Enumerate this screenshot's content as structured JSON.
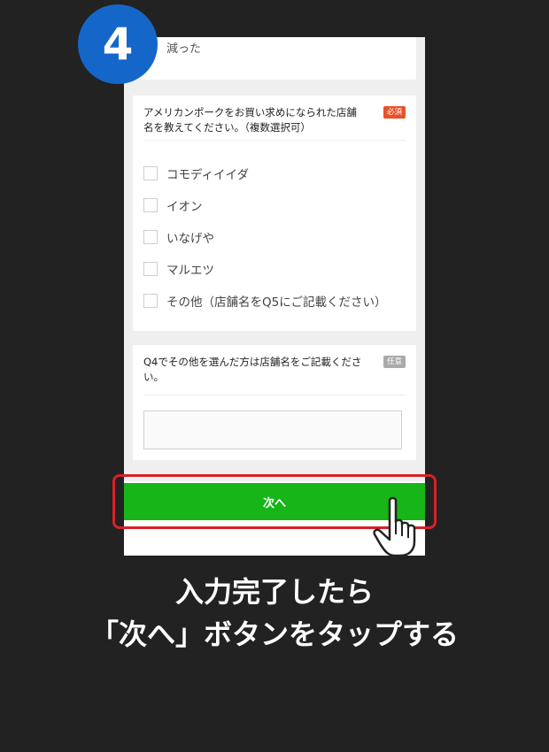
{
  "step": {
    "number": "4"
  },
  "previous_card": {
    "text": "減った"
  },
  "question3": {
    "title": "アメリカンポークをお買い求めになられた店舗名を教えてください。（複数選択可）",
    "tag": "必須",
    "options": [
      {
        "label": "コモディイイダ",
        "checked": false
      },
      {
        "label": "イオン",
        "checked": false
      },
      {
        "label": "いなげや",
        "checked": false
      },
      {
        "label": "マルエツ",
        "checked": false
      },
      {
        "label": "その他（店舗名をQ5にご記載ください）",
        "checked": false
      }
    ]
  },
  "question4": {
    "title": "Q4でその他を選んだ方は店舗名をご記載ください。",
    "tag": "任意",
    "value": ""
  },
  "next_button": {
    "label": "次へ"
  },
  "caption": {
    "line1": "入力完了したら",
    "line2": "「次へ」ボタンをタップする"
  },
  "colors": {
    "background": "#222222",
    "badge": "#1467c8",
    "button": "#17b517",
    "highlight": "#d8202a",
    "required_tag": "#e8502b",
    "optional_tag": "#aaaaaa"
  }
}
